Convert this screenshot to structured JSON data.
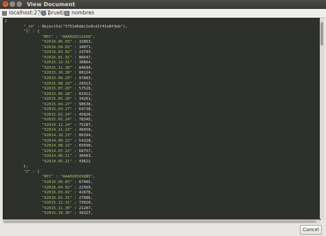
{
  "window": {
    "title": "View Document"
  },
  "breadcrumb": {
    "server": "localhost:27017",
    "database": "prueba",
    "collection": "nombres"
  },
  "document": {
    "open_brace": "{",
    "id_key": "_id",
    "id_value": "ObjectId(\"5751d6ddc1e0cd1f41e8f3eb\")",
    "entries": [
      {
        "key": "1",
        "rfc": "AAA020211GV8",
        "fields": [
          [
            "X2016.05.03",
            "32863"
          ],
          [
            "X2016.04.02",
            "34071"
          ],
          [
            "X2016.03.02",
            "23793"
          ],
          [
            "X2016.01.31",
            "86647"
          ],
          [
            "X2015.12.31",
            "30864"
          ],
          [
            "X2015.11.30",
            "84694"
          ],
          [
            "X2015.10.30",
            "80124"
          ],
          [
            "X2015.09.29",
            "97883"
          ],
          [
            "X2015.08.29",
            "29913"
          ],
          [
            "X2015.07.29",
            "57526"
          ],
          [
            "X2015.06.28",
            "82922"
          ],
          [
            "X2015.05.28",
            "34261"
          ],
          [
            "X2015.04.27",
            "98638"
          ],
          [
            "X2015.03.27",
            "64738"
          ],
          [
            "X2015.02.24",
            "45826"
          ],
          [
            "X2015.01.24",
            "78345"
          ],
          [
            "X2014.12.24",
            "75287"
          ],
          [
            "X2014.11.23",
            "46050"
          ],
          [
            "X2014.10.23",
            "86394"
          ],
          [
            "X2014.09.22",
            "54328"
          ],
          [
            "X2014.08.22",
            "65690"
          ],
          [
            "X2014.07.22",
            "68757"
          ],
          [
            "X2014.06.21",
            "30403"
          ],
          [
            "X2014.05.21",
            "43622"
          ]
        ]
      },
      {
        "key": "2",
        "rfc": "AAA020503QN5",
        "fields": [
          [
            "X2016.05.03",
            "67405"
          ],
          [
            "X2016.04.02",
            "22569"
          ],
          [
            "X2016.03.02",
            "41878"
          ],
          [
            "X2016.01.31",
            "27986"
          ],
          [
            "X2015.12.31",
            "73020"
          ],
          [
            "X2015.11.30",
            "21287"
          ],
          [
            "X2015.10.30",
            "39327"
          ]
        ]
      }
    ]
  },
  "buttons": {
    "cancel": "Cancel"
  }
}
